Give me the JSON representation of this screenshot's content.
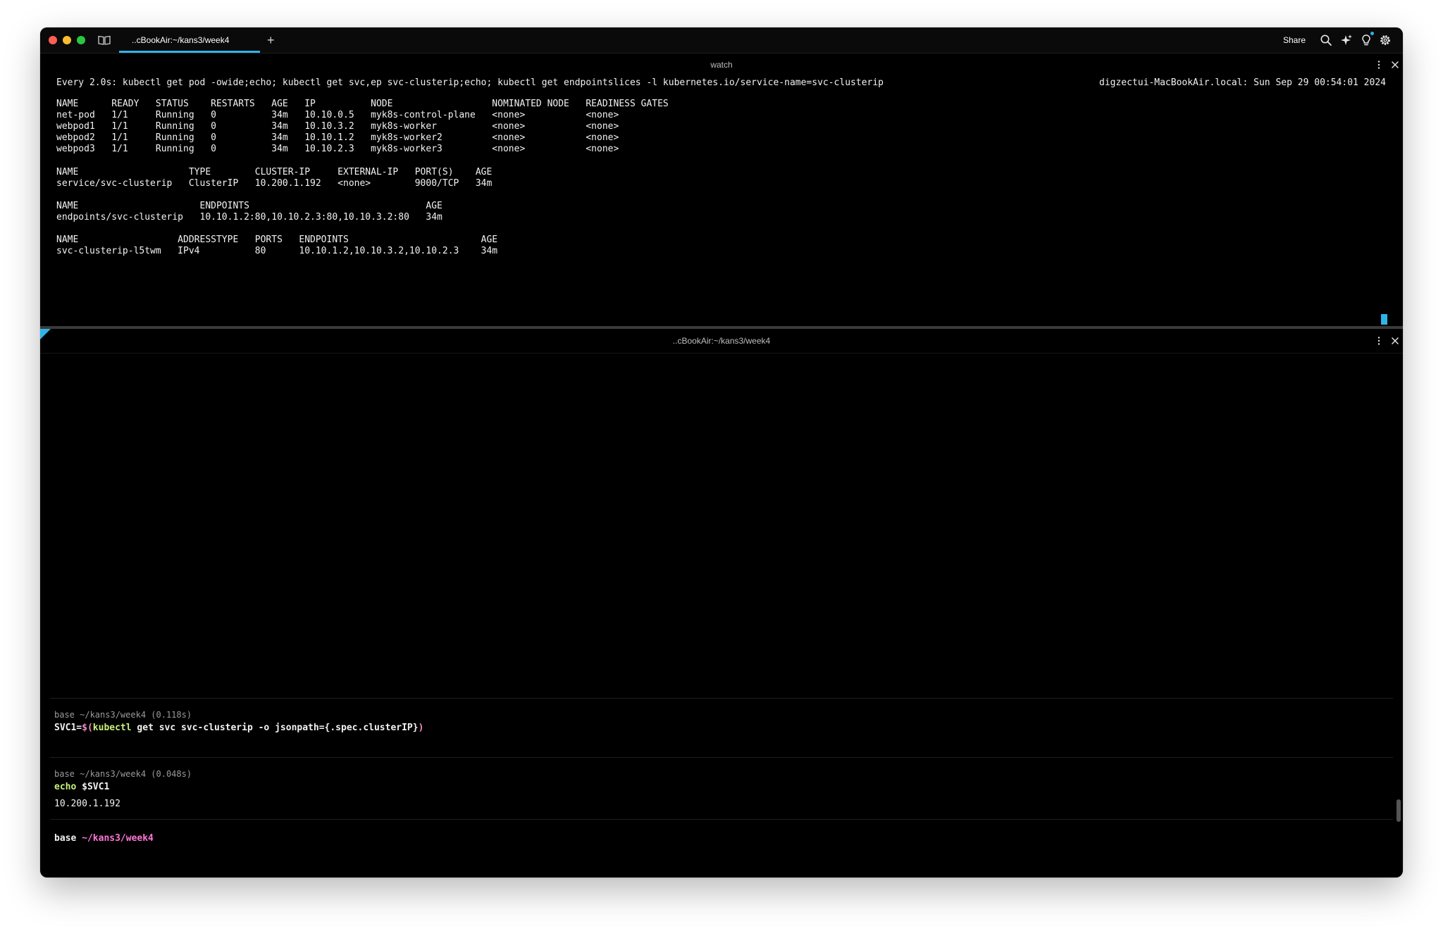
{
  "titlebar": {
    "tab_title": "..cBookAir:~/kans3/week4",
    "new_tab_symbol": "+",
    "share_label": "Share",
    "icons": [
      "book-icon",
      "search-icon",
      "sparkles-icon",
      "lightbulb-icon",
      "gear-icon"
    ],
    "accent_color": "#2fb4e8"
  },
  "top_pane": {
    "title": "watch",
    "command": "Every 2.0s: kubectl get pod -owide;echo; kubectl get svc,ep svc-clusterip;echo; kubectl get endpointslices -l kubernetes.io/service-name=svc-clusterip",
    "host": "digzectui-MacBookAir.local: Sun Sep 29 00:54:01 2024",
    "output": "NAME      READY   STATUS    RESTARTS   AGE   IP          NODE                  NOMINATED NODE   READINESS GATES\nnet-pod   1/1     Running   0          34m   10.10.0.5   myk8s-control-plane   <none>           <none>\nwebpod1   1/1     Running   0          34m   10.10.3.2   myk8s-worker          <none>           <none>\nwebpod2   1/1     Running   0          34m   10.10.1.2   myk8s-worker2         <none>           <none>\nwebpod3   1/1     Running   0          34m   10.10.2.3   myk8s-worker3         <none>           <none>\n\nNAME                    TYPE        CLUSTER-IP     EXTERNAL-IP   PORT(S)    AGE\nservice/svc-clusterip   ClusterIP   10.200.1.192   <none>        9000/TCP   34m\n\nNAME                      ENDPOINTS                                AGE\nendpoints/svc-clusterip   10.10.1.2:80,10.10.2.3:80,10.10.3.2:80   34m\n\nNAME                  ADDRESSTYPE   PORTS   ENDPOINTS                        AGE\nsvc-clusterip-l5twm   IPv4          80      10.10.1.2,10.10.3.2,10.10.2.3    34m"
  },
  "bottom_pane": {
    "title": "..cBookAir:~/kans3/week4",
    "blocks": [
      {
        "meta": "base ~/kans3/week4 (0.118s)",
        "cmd_var": "SVC1=",
        "cmd_open": "$(",
        "cmd_kw": "kubectl",
        "cmd_rest": " get svc svc-clusterip -o jsonpath={.spec.clusterIP}",
        "cmd_close": ")"
      },
      {
        "meta": "base ~/kans3/week4 (0.048s)",
        "cmd_kw": "echo",
        "cmd_rest": " $SVC1",
        "output": "10.200.1.192"
      }
    ],
    "prompt_env": "base",
    "prompt_path": "~/kans3/week4",
    "prompt_path_color": "#ff77d7"
  }
}
